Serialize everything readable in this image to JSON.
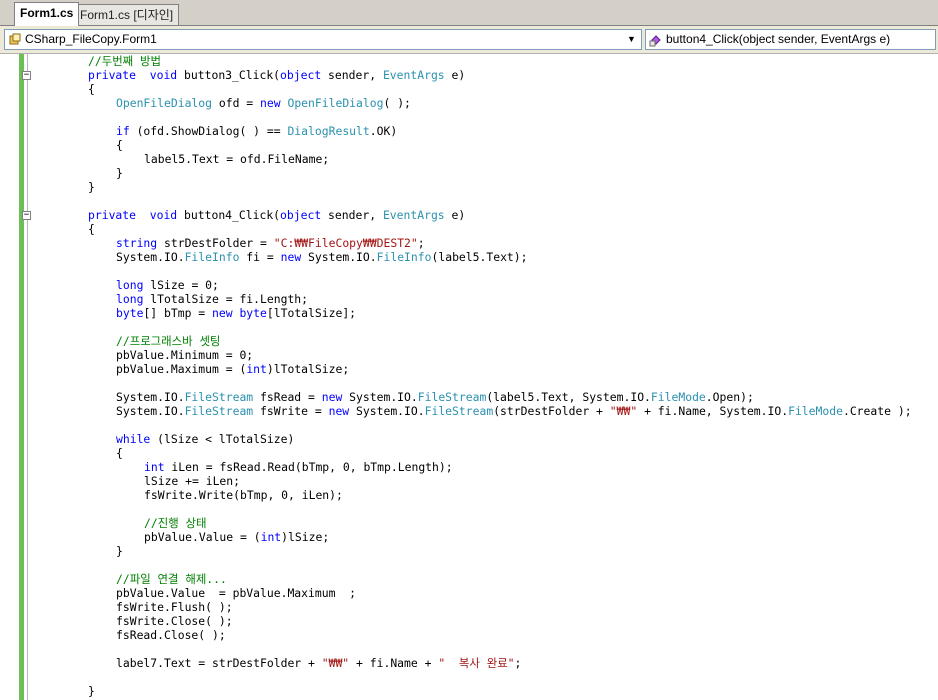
{
  "tabs": [
    {
      "label": "Form1.cs",
      "active": true
    },
    {
      "label": "Form1.cs [디자인]",
      "active": false
    }
  ],
  "nav": {
    "class_combo": "CSharp_FileCopy.Form1",
    "member_combo": "button4_Click(object sender, EventArgs e)"
  },
  "colors": {
    "keyword": "#0000ff",
    "type": "#2b91af",
    "comment": "#008000",
    "string": "#a31515",
    "changed_margin": "#6bbf54"
  },
  "code_lines": [
    {
      "i": 8,
      "t": [
        [
          "cm",
          "//두번째 방법"
        ]
      ]
    },
    {
      "i": 8,
      "t": [
        [
          "kw",
          "private"
        ],
        [
          "",
          "  "
        ],
        [
          "kw",
          "void"
        ],
        [
          "",
          " button3_Click("
        ],
        [
          "kw",
          "object"
        ],
        [
          "",
          " sender, "
        ],
        [
          "ty",
          "EventArgs"
        ],
        [
          "",
          " e)"
        ]
      ],
      "fold": "-"
    },
    {
      "i": 8,
      "t": [
        [
          "",
          "{"
        ]
      ]
    },
    {
      "i": 12,
      "t": [
        [
          "ty",
          "OpenFileDialog"
        ],
        [
          "",
          " ofd = "
        ],
        [
          "kw",
          "new"
        ],
        [
          "",
          ""
        ],
        [
          "ty",
          " OpenFileDialog"
        ],
        [
          "",
          "( );"
        ]
      ]
    },
    {
      "i": 0,
      "t": []
    },
    {
      "i": 12,
      "t": [
        [
          "kw",
          "if"
        ],
        [
          "",
          " (ofd.ShowDialog( ) == "
        ],
        [
          "ty",
          "DialogResult"
        ],
        [
          "",
          ".OK)"
        ]
      ]
    },
    {
      "i": 12,
      "t": [
        [
          "",
          "{"
        ]
      ]
    },
    {
      "i": 16,
      "t": [
        [
          "",
          "label5.Text = ofd.FileName;"
        ]
      ]
    },
    {
      "i": 12,
      "t": [
        [
          "",
          "}"
        ]
      ]
    },
    {
      "i": 8,
      "t": [
        [
          "",
          "}"
        ]
      ]
    },
    {
      "i": 0,
      "t": []
    },
    {
      "i": 8,
      "t": [
        [
          "kw",
          "private"
        ],
        [
          "",
          "  "
        ],
        [
          "kw",
          "void"
        ],
        [
          "",
          " button4_Click("
        ],
        [
          "kw",
          "object"
        ],
        [
          "",
          " sender, "
        ],
        [
          "ty",
          "EventArgs"
        ],
        [
          "",
          " e)"
        ]
      ],
      "fold": "-"
    },
    {
      "i": 8,
      "t": [
        [
          "",
          "{"
        ]
      ]
    },
    {
      "i": 12,
      "t": [
        [
          "kw",
          "string"
        ],
        [
          "",
          " strDestFolder = "
        ],
        [
          "st",
          "\"C:₩₩FileCopy₩₩DEST2\""
        ],
        [
          "",
          ";"
        ]
      ]
    },
    {
      "i": 12,
      "t": [
        [
          "",
          "System.IO."
        ],
        [
          "ty",
          "FileInfo"
        ],
        [
          "",
          " fi = "
        ],
        [
          "kw",
          "new"
        ],
        [
          "",
          " System.IO."
        ],
        [
          "ty",
          "FileInfo"
        ],
        [
          "",
          "(label5.Text);"
        ]
      ]
    },
    {
      "i": 0,
      "t": []
    },
    {
      "i": 12,
      "t": [
        [
          "kw",
          "long"
        ],
        [
          "",
          " lSize = 0;"
        ]
      ]
    },
    {
      "i": 12,
      "t": [
        [
          "kw",
          "long"
        ],
        [
          "",
          " lTotalSize = fi.Length;"
        ]
      ]
    },
    {
      "i": 12,
      "t": [
        [
          "kw",
          "byte"
        ],
        [
          "",
          "[] bTmp = "
        ],
        [
          "kw",
          "new"
        ],
        [
          "",
          ""
        ],
        [
          "kw",
          " byte"
        ],
        [
          "",
          "[lTotalSize];"
        ]
      ]
    },
    {
      "i": 0,
      "t": []
    },
    {
      "i": 12,
      "t": [
        [
          "cm",
          "//프로그래스바 셋팅"
        ]
      ]
    },
    {
      "i": 12,
      "t": [
        [
          "",
          "pbValue.Minimum = 0;"
        ]
      ]
    },
    {
      "i": 12,
      "t": [
        [
          "",
          "pbValue.Maximum = ("
        ],
        [
          "kw",
          "int"
        ],
        [
          "",
          ")lTotalSize;"
        ]
      ]
    },
    {
      "i": 0,
      "t": []
    },
    {
      "i": 12,
      "t": [
        [
          "",
          "System.IO."
        ],
        [
          "ty",
          "FileStream"
        ],
        [
          "",
          " fsRead = "
        ],
        [
          "kw",
          "new"
        ],
        [
          "",
          " System.IO."
        ],
        [
          "ty",
          "FileStream"
        ],
        [
          "",
          "(label5.Text, System.IO."
        ],
        [
          "ty",
          "FileMode"
        ],
        [
          "",
          ".Open);"
        ]
      ]
    },
    {
      "i": 12,
      "t": [
        [
          "",
          "System.IO."
        ],
        [
          "ty",
          "FileStream"
        ],
        [
          "",
          " fsWrite = "
        ],
        [
          "kw",
          "new"
        ],
        [
          "",
          " System.IO."
        ],
        [
          "ty",
          "FileStream"
        ],
        [
          "",
          "(strDestFolder + "
        ],
        [
          "st",
          "\"₩₩\""
        ],
        [
          "",
          " + fi.Name, System.IO."
        ],
        [
          "ty",
          "FileMode"
        ],
        [
          "",
          ".Create );"
        ]
      ]
    },
    {
      "i": 0,
      "t": []
    },
    {
      "i": 12,
      "t": [
        [
          "kw",
          "while"
        ],
        [
          "",
          " (lSize < lTotalSize)"
        ]
      ]
    },
    {
      "i": 12,
      "t": [
        [
          "",
          "{"
        ]
      ]
    },
    {
      "i": 16,
      "t": [
        [
          "kw",
          "int"
        ],
        [
          "",
          " iLen = fsRead.Read(bTmp, 0, bTmp.Length);"
        ]
      ]
    },
    {
      "i": 16,
      "t": [
        [
          "",
          "lSize += iLen;"
        ]
      ]
    },
    {
      "i": 16,
      "t": [
        [
          "",
          "fsWrite.Write(bTmp, 0, iLen);"
        ]
      ]
    },
    {
      "i": 0,
      "t": []
    },
    {
      "i": 16,
      "t": [
        [
          "cm",
          "//진행 상태"
        ]
      ]
    },
    {
      "i": 16,
      "t": [
        [
          "",
          "pbValue.Value = ("
        ],
        [
          "kw",
          "int"
        ],
        [
          "",
          ")lSize;"
        ]
      ]
    },
    {
      "i": 12,
      "t": [
        [
          "",
          "}"
        ]
      ]
    },
    {
      "i": 0,
      "t": []
    },
    {
      "i": 12,
      "t": [
        [
          "cm",
          "//파일 연결 해제..."
        ]
      ]
    },
    {
      "i": 12,
      "t": [
        [
          "",
          "pbValue.Value  = pbValue.Maximum  ;"
        ]
      ]
    },
    {
      "i": 12,
      "t": [
        [
          "",
          "fsWrite.Flush( );"
        ]
      ]
    },
    {
      "i": 12,
      "t": [
        [
          "",
          "fsWrite.Close( );"
        ]
      ]
    },
    {
      "i": 12,
      "t": [
        [
          "",
          "fsRead.Close( );"
        ]
      ]
    },
    {
      "i": 0,
      "t": []
    },
    {
      "i": 12,
      "t": [
        [
          "",
          "label7.Text = strDestFolder + "
        ],
        [
          "st",
          "\"₩₩\""
        ],
        [
          "",
          " + fi.Name + "
        ],
        [
          "st",
          "\"  복사 완료\""
        ],
        [
          "",
          ";"
        ]
      ]
    },
    {
      "i": 0,
      "t": []
    },
    {
      "i": 8,
      "t": [
        [
          "",
          "}"
        ]
      ]
    }
  ]
}
